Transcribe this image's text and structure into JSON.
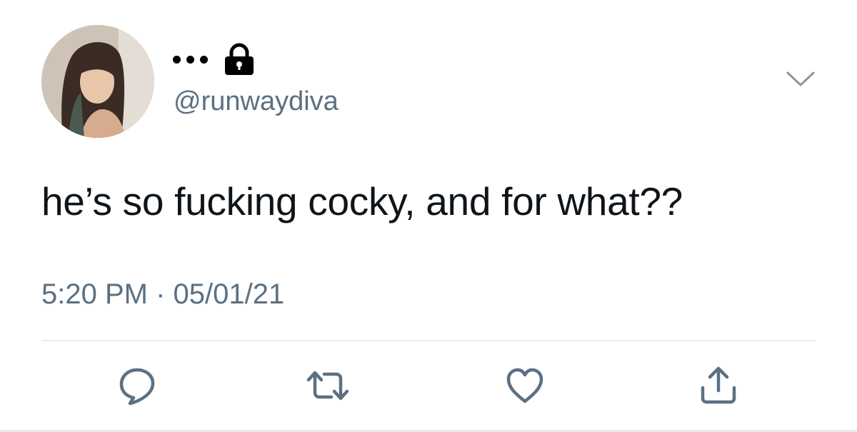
{
  "tweet": {
    "display_name_dots": "•••",
    "handle": "@runwaydiva",
    "text": "he’s so fucking cocky, and for what??",
    "timestamp": "5:20 PM · 05/01/21"
  },
  "icons": {
    "avatar": "profile-photo",
    "lock": "lock-icon",
    "more": "chevron-down-icon",
    "reply": "reply-icon",
    "retweet": "retweet-icon",
    "like": "heart-icon",
    "share": "share-icon"
  },
  "colors": {
    "text": "#0f1419",
    "secondary": "#5b7083",
    "divider": "#e6ecf0",
    "icon": "#5b7083"
  }
}
